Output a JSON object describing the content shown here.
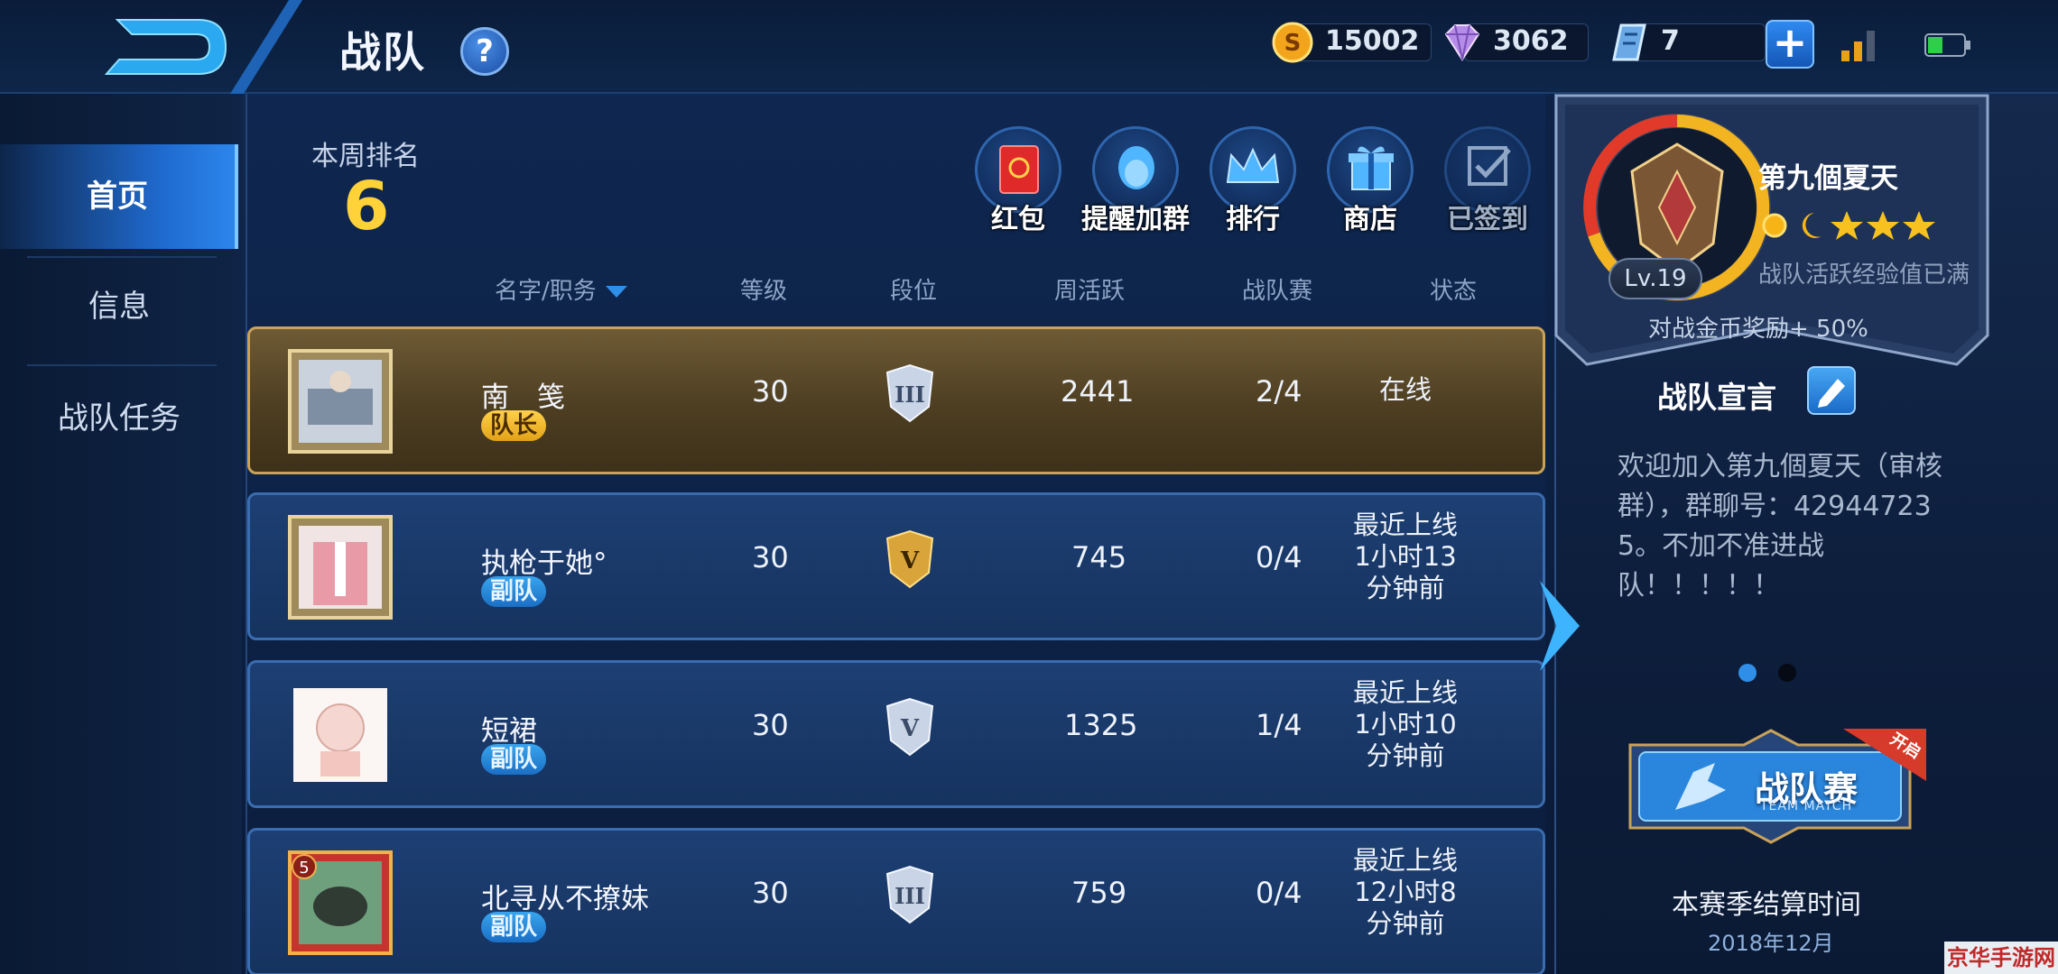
{
  "header": {
    "title": "战队",
    "help_label": "?",
    "coins": "15002",
    "diamonds": "3062",
    "vouchers": "7",
    "plus_label": "+"
  },
  "sidebar": {
    "items": [
      {
        "label": "首页",
        "active": true
      },
      {
        "label": "信息",
        "active": false
      },
      {
        "label": "战队任务",
        "active": false
      }
    ]
  },
  "weekly": {
    "label": "本周排名",
    "value": "6"
  },
  "actions": [
    {
      "label": "红包",
      "icon": "red-envelope-icon"
    },
    {
      "label": "提醒加群",
      "icon": "qq-penguin-icon"
    },
    {
      "label": "排行",
      "icon": "crown-icon"
    },
    {
      "label": "商店",
      "icon": "gift-icon"
    },
    {
      "label": "已签到",
      "icon": "checked-icon"
    }
  ],
  "table": {
    "headers": [
      "名字/职务",
      "等级",
      "段位",
      "周活跃",
      "战队赛",
      "状态"
    ],
    "rows": [
      {
        "name": "南　笺",
        "role": "队长",
        "level": "30",
        "weekly_active": "2441",
        "team_match": "2/4",
        "status": "在线",
        "tier": "III",
        "leader": true
      },
      {
        "name": "执枪于她°",
        "role": "副队",
        "level": "30",
        "weekly_active": "745",
        "team_match": "0/4",
        "status": "最近上线\n1小时13\n分钟前",
        "tier": "V",
        "leader": false
      },
      {
        "name": "短裙",
        "role": "副队",
        "level": "30",
        "weekly_active": "1325",
        "team_match": "1/4",
        "status": "最近上线\n1小时10\n分钟前",
        "tier": "V",
        "leader": false
      },
      {
        "name": "北寻从不撩妹",
        "role": "副队",
        "level": "30",
        "weekly_active": "759",
        "team_match": "0/4",
        "status": "最近上线\n12小时8\n分钟前",
        "tier": "III",
        "leader": false
      }
    ]
  },
  "team": {
    "name": "第九個夏天",
    "level": "Lv.19",
    "active_full": "战队活跃经验值已满",
    "reward": "对战金币奖励+ 50%",
    "declaration_title": "战队宣言",
    "declaration": "欢迎加入第九個夏天（审核群），群聊号：429447235。不加不准进战队！！！！！",
    "team_match_label": "战队赛",
    "team_match_sub": "TEAM MATCH",
    "open_badge": "开启",
    "season_label": "本赛季结算时间",
    "season_date": "2018年12月"
  },
  "watermark": "京华手游网",
  "colors": {
    "accent_gold": "#ffd23a",
    "accent_blue": "#2d86ec",
    "leader_bg": "#6e5a34"
  }
}
